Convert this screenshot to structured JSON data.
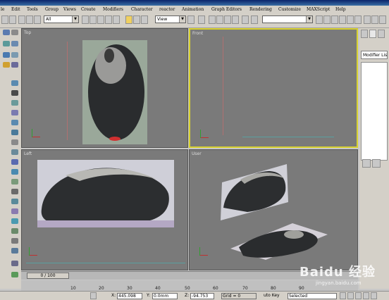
{
  "menu": [
    "le",
    "Edit",
    "Tools",
    "Group",
    "Views",
    "Create",
    "Modifiers",
    "Character",
    "reactor",
    "Animation",
    "Graph Editors",
    "Rendering",
    "Customize",
    "MAXScript",
    "Help"
  ],
  "toolbar": {
    "filter_value": "All",
    "refcoord_value": "View",
    "named_selection_value": ""
  },
  "viewports": {
    "top": {
      "label": "Top"
    },
    "front": {
      "label": "Front"
    },
    "left": {
      "label": "Left"
    },
    "user": {
      "label": "User"
    }
  },
  "right_panel": {
    "modifier_list": "Modifier List"
  },
  "timeline": {
    "slider": "0 / 100"
  },
  "ruler_ticks": [
    "10",
    "20",
    "30",
    "40",
    "50",
    "60",
    "70",
    "80",
    "90"
  ],
  "status": {
    "x_label": "X:",
    "x_value": "445.098",
    "y_label": "Y:",
    "y_value": "0.0mm",
    "z_label": "Z:",
    "z_value": "-94.753",
    "grid": "Grid = 0",
    "autokey": "uto Key",
    "selected": "Selected"
  },
  "watermark": {
    "brand": "Baidu 经验",
    "url": "jingyan.baidu.com"
  },
  "colors": {
    "active_viewport": "#d8d230",
    "viewport_bg": "#7a7a7a"
  }
}
